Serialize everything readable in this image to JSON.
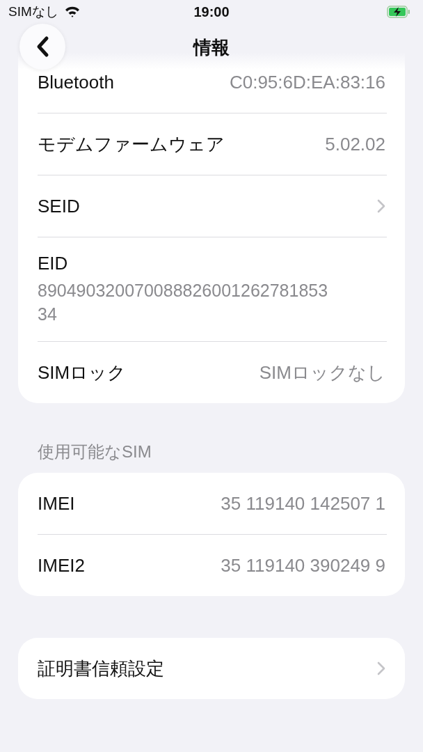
{
  "status_bar": {
    "carrier": "SIMなし",
    "time": "19:00",
    "battery_charging": true
  },
  "nav": {
    "title": "情報"
  },
  "sections": [
    {
      "rows": [
        {
          "kind": "value",
          "label": "Bluetooth",
          "value": "C0:95:6D:EA:83:16"
        },
        {
          "kind": "value",
          "label": "モデムファームウェア",
          "value": "5.02.02"
        },
        {
          "kind": "link",
          "label": "SEID"
        },
        {
          "kind": "stacked",
          "label": "EID",
          "value": "89049032007008882600126278185334"
        },
        {
          "kind": "value",
          "label": "SIMロック",
          "value": "SIMロックなし"
        }
      ]
    },
    {
      "header": "使用可能なSIM",
      "rows": [
        {
          "kind": "value",
          "label": "IMEI",
          "value": "35 119140 142507 1"
        },
        {
          "kind": "value",
          "label": "IMEI2",
          "value": "35 119140 390249 9"
        }
      ]
    },
    {
      "rows": [
        {
          "kind": "link",
          "label": "証明書信頼設定"
        }
      ]
    }
  ]
}
